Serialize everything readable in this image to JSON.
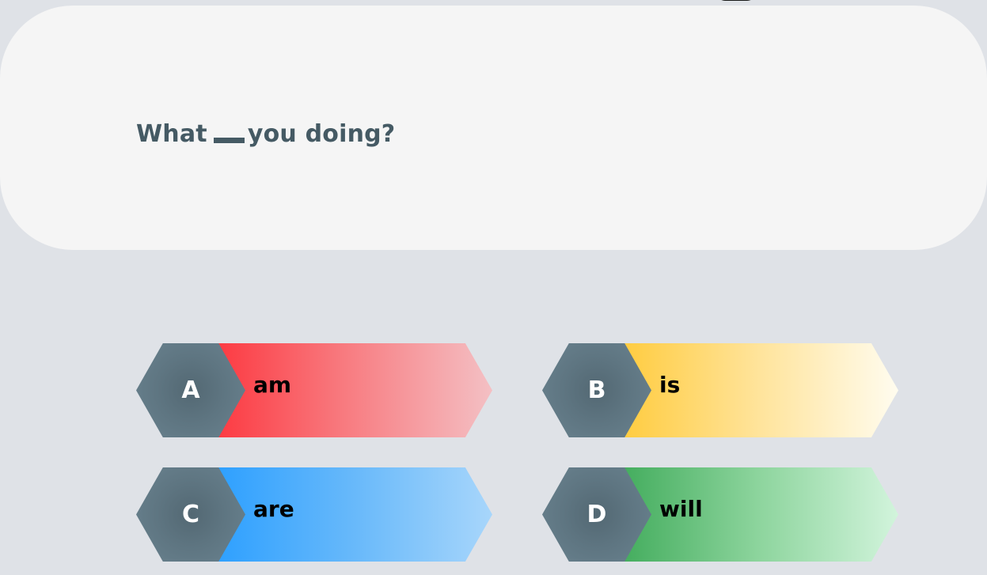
{
  "question": {
    "before_blank": "What",
    "after_blank": "you doing?"
  },
  "options": [
    {
      "letter": "A",
      "text": "am",
      "color": "#fc3a42"
    },
    {
      "letter": "B",
      "text": "is",
      "color": "#ffcc40"
    },
    {
      "letter": "C",
      "text": "are",
      "color": "#2ea0ff"
    },
    {
      "letter": "D",
      "text": "will",
      "color": "#44ad5e"
    }
  ],
  "colors": {
    "background": "#dfe2e7",
    "card": "#f5f5f5",
    "question_text": "#455a64",
    "hexagon": "#5e7581"
  }
}
